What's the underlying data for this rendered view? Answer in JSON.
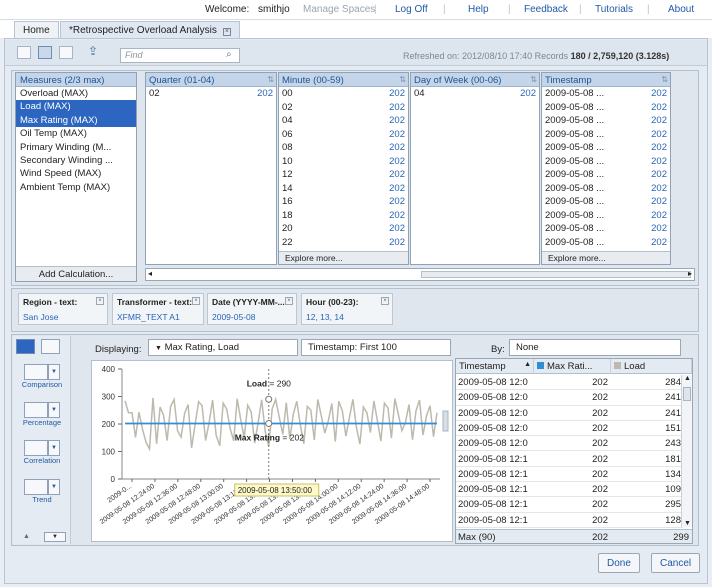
{
  "topbar": {
    "welcome": "Welcome:",
    "user": "smithjo",
    "manage_spaces": "Manage Spaces",
    "links": [
      "Log Off",
      "Help",
      "Feedback",
      "Tutorials",
      "About"
    ]
  },
  "tabs": [
    {
      "label": "Home"
    },
    {
      "label": "*Retrospective Overload Analysis"
    }
  ],
  "toolbar": {
    "find_placeholder": "Find",
    "refreshed_label": "Refreshed on: 2012/08/10 17:40",
    "records_label": "Records",
    "records_value": "180 / 2,759,120 (3.128s)"
  },
  "measures": {
    "header": "Measures (2/3 max)",
    "items": [
      {
        "label": "Overload (MAX)",
        "selected": false
      },
      {
        "label": "Load (MAX)",
        "selected": true
      },
      {
        "label": "Max Rating (MAX)",
        "selected": true
      },
      {
        "label": "Oil Temp (MAX)",
        "selected": false
      },
      {
        "label": "Primary Winding (M...",
        "selected": false
      },
      {
        "label": "Secondary Winding ...",
        "selected": false
      },
      {
        "label": "Wind Speed (MAX)",
        "selected": false
      },
      {
        "label": "Ambient Temp (MAX)",
        "selected": false
      }
    ],
    "add_calc": "Add Calculation..."
  },
  "columns": {
    "quarter": {
      "header": "Quarter (01-04)",
      "rows": [
        {
          "v": "02",
          "c": "202"
        }
      ]
    },
    "minute": {
      "header": "Minute (00-59)",
      "rows": [
        {
          "v": "00",
          "c": "202"
        },
        {
          "v": "02",
          "c": "202"
        },
        {
          "v": "04",
          "c": "202"
        },
        {
          "v": "06",
          "c": "202"
        },
        {
          "v": "08",
          "c": "202"
        },
        {
          "v": "10",
          "c": "202"
        },
        {
          "v": "12",
          "c": "202"
        },
        {
          "v": "14",
          "c": "202"
        },
        {
          "v": "16",
          "c": "202"
        },
        {
          "v": "18",
          "c": "202"
        },
        {
          "v": "20",
          "c": "202"
        },
        {
          "v": "22",
          "c": "202"
        }
      ],
      "explore": "Explore more..."
    },
    "dow": {
      "header": "Day of Week (00-06)",
      "rows": [
        {
          "v": "04",
          "c": "202"
        }
      ]
    },
    "timestamp": {
      "header": "Timestamp",
      "rows": [
        {
          "v": "2009-05-08 ...",
          "c": "202"
        },
        {
          "v": "2009-05-08 ...",
          "c": "202"
        },
        {
          "v": "2009-05-08 ...",
          "c": "202"
        },
        {
          "v": "2009-05-08 ...",
          "c": "202"
        },
        {
          "v": "2009-05-08 ...",
          "c": "202"
        },
        {
          "v": "2009-05-08 ...",
          "c": "202"
        },
        {
          "v": "2009-05-08 ...",
          "c": "202"
        },
        {
          "v": "2009-05-08 ...",
          "c": "202"
        },
        {
          "v": "2009-05-08 ...",
          "c": "202"
        },
        {
          "v": "2009-05-08 ...",
          "c": "202"
        },
        {
          "v": "2009-05-08 ...",
          "c": "202"
        },
        {
          "v": "2009-05-08 ...",
          "c": "202"
        }
      ],
      "explore": "Explore more..."
    }
  },
  "filters": [
    {
      "label": "Region - text:",
      "value": "San Jose"
    },
    {
      "label": "Transformer - text:",
      "value": "XFMR_TEXT A1"
    },
    {
      "label": "Date (YYYY-MM-...",
      "value": "2009-05-08"
    },
    {
      "label": "Hour (00-23):",
      "value": "12, 13, 14"
    }
  ],
  "charttypes": [
    {
      "label": "Comparison"
    },
    {
      "label": "Percentage"
    },
    {
      "label": "Correlation"
    },
    {
      "label": "Trend"
    }
  ],
  "viz": {
    "displaying_label": "Displaying:",
    "displaying_value": "Max Rating, Load",
    "timestamp_select": "Timestamp: First 100",
    "by_label": "By:",
    "by_value": "None"
  },
  "chart_data": {
    "type": "line",
    "ylim": [
      0,
      400
    ],
    "yticks": [
      0,
      100,
      200,
      300,
      400
    ],
    "xtick_labels": [
      "2009-0...",
      "2009-05-08 12:24:00",
      "2009-05-08 12:36:00",
      "2009-05-08 12:48:00",
      "2009-05-08 13:00:00",
      "2009-05-08 13:12:00",
      "2009-05-08 13:24:00",
      "2009-05-08 13:36:00",
      "2009-05-08 13:48:00",
      "2009-05-08 14:00:00",
      "2009-05-08 14:12:00",
      "2009-05-08 14:24:00",
      "2009-05-08 14:36:00",
      "2009-05-08 14:48:00"
    ],
    "series": [
      {
        "name": "Max Rating",
        "color": "#2f8fd6",
        "values": [
          202,
          202,
          202,
          202,
          202,
          202,
          202,
          202,
          202,
          202,
          202,
          202,
          202,
          202,
          202,
          202,
          202,
          202,
          202,
          202,
          202,
          202,
          202,
          202,
          202,
          202,
          202,
          202,
          202,
          202,
          202,
          202,
          202,
          202,
          202,
          202,
          202,
          202,
          202,
          202,
          202,
          202,
          202,
          202,
          202,
          202,
          202,
          202,
          202,
          202,
          202,
          202,
          202,
          202,
          202,
          202,
          202,
          202,
          202,
          202,
          202,
          202,
          202,
          202,
          202,
          202,
          202,
          202,
          202,
          202,
          202,
          202,
          202,
          202,
          202,
          202,
          202,
          202,
          202,
          202,
          202,
          202,
          202,
          202,
          202,
          202,
          202,
          202,
          202,
          202
        ]
      },
      {
        "name": "Load",
        "color": "#bdb9ad",
        "values": [
          284,
          241,
          241,
          151,
          243,
          181,
          134,
          109,
          295,
          128,
          262,
          231,
          140,
          264,
          289,
          175,
          152,
          238,
          271,
          113,
          198,
          281,
          266,
          140,
          205,
          287,
          160,
          121,
          276,
          254,
          183,
          139,
          292,
          216,
          150,
          268,
          244,
          131,
          207,
          288,
          173,
          119,
          255,
          290,
          226,
          162,
          278,
          145,
          236,
          283,
          197,
          128,
          264,
          251,
          142,
          289,
          230,
          167,
          211,
          274,
          136,
          283,
          248,
          156,
          223,
          290,
          188,
          127,
          262,
          241,
          169,
          284,
          212,
          138,
          276,
          259,
          149,
          292,
          234,
          176,
          205,
          271,
          143,
          248,
          287,
          160,
          229,
          266,
          154,
          241
        ]
      }
    ],
    "hover": {
      "timestamp": "2009-05-08 13:50:00",
      "load_label": "Load",
      "load_value": "= 290",
      "rating_label": "Max Rating",
      "rating_value": "= 202"
    }
  },
  "table": {
    "headers": [
      "Timestamp",
      "Max Rati...",
      "Load"
    ],
    "rows": [
      [
        "2009-05-08 12:0",
        "202",
        "284"
      ],
      [
        "2009-05-08 12:0",
        "202",
        "241"
      ],
      [
        "2009-05-08 12:0",
        "202",
        "241"
      ],
      [
        "2009-05-08 12:0",
        "202",
        "151"
      ],
      [
        "2009-05-08 12:0",
        "202",
        "243"
      ],
      [
        "2009-05-08 12:1",
        "202",
        "181"
      ],
      [
        "2009-05-08 12:1",
        "202",
        "134"
      ],
      [
        "2009-05-08 12:1",
        "202",
        "109"
      ],
      [
        "2009-05-08 12:1",
        "202",
        "295"
      ],
      [
        "2009-05-08 12:1",
        "202",
        "128"
      ]
    ],
    "footer": [
      "Max (90)",
      "202",
      "299"
    ],
    "max_rating_color": "#2f8fd6",
    "load_color": "#bdb9ad"
  },
  "buttons": {
    "done": "Done",
    "cancel": "Cancel"
  }
}
